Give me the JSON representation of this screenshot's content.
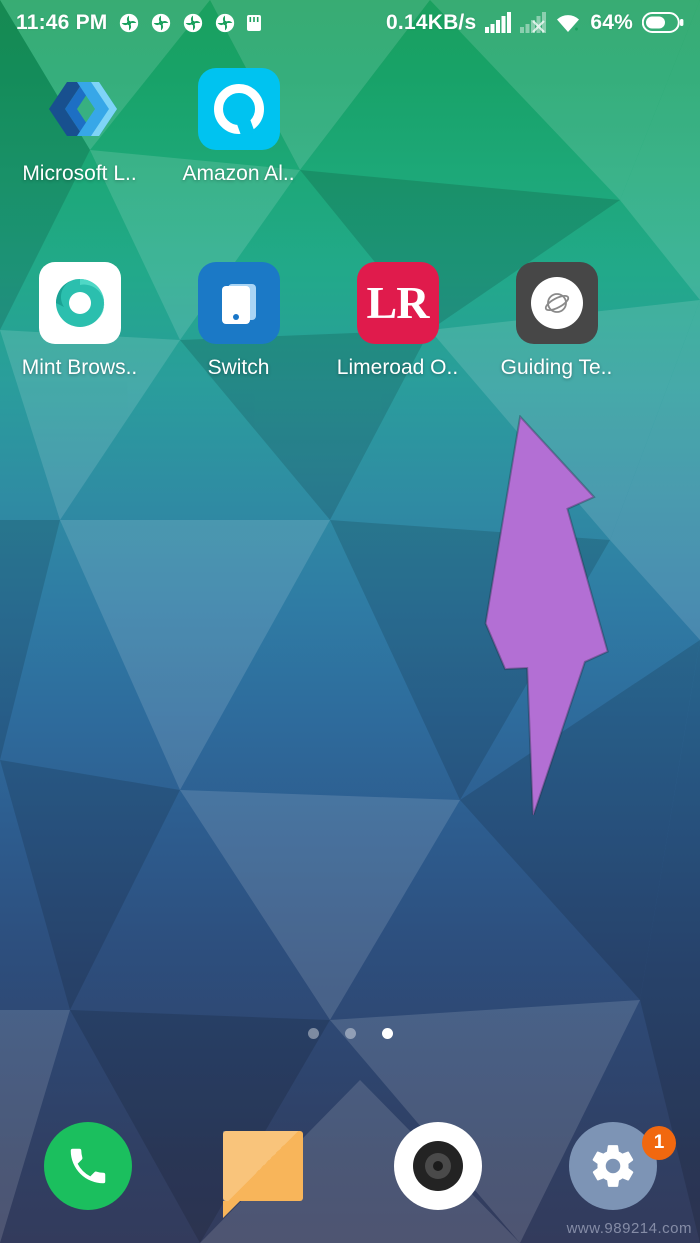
{
  "status_bar": {
    "time": "11:46 PM",
    "left_icons": [
      "sync-icon",
      "sync-icon",
      "sync-icon",
      "sync-icon",
      "sd-card-icon"
    ],
    "network_speed": "0.14KB/s",
    "right_icons": [
      "signal-bars-full-icon",
      "signal-bars-none-icon",
      "wifi-icon"
    ],
    "battery_percent": "64%",
    "battery_icon": "battery-icon"
  },
  "home_screen": {
    "rows": [
      {
        "apps": [
          {
            "label": "Microsoft L..",
            "icon": "microsoft-launcher-icon"
          },
          {
            "label": "Amazon Al..",
            "icon": "amazon-alexa-icon"
          }
        ]
      },
      {
        "apps": [
          {
            "label": "Mint Brows..",
            "icon": "mint-browser-icon"
          },
          {
            "label": "Switch",
            "icon": "switch-icon"
          },
          {
            "label": "Limeroad O..",
            "icon": "limeroad-icon",
            "glyph": "LR"
          },
          {
            "label": "Guiding Te..",
            "icon": "guiding-tech-icon"
          }
        ]
      }
    ],
    "page_indicator": {
      "count": 3,
      "active_index": 2
    }
  },
  "dock": {
    "items": [
      {
        "label": "Phone",
        "icon": "phone-icon"
      },
      {
        "label": "Messages",
        "icon": "message-bubble-icon"
      },
      {
        "label": "Camera",
        "icon": "camera-icon"
      },
      {
        "label": "Settings",
        "icon": "gear-icon",
        "badge": "1"
      }
    ]
  },
  "annotation": {
    "arrow": {
      "color": "#b36fd4",
      "direction": "up-right",
      "points_to": "Guiding Te.."
    }
  },
  "watermark": {
    "text": "www.989214.com"
  },
  "colors": {
    "wallpaper_top": "#1aa05e",
    "wallpaper_bottom": "#333b5c",
    "alexa_blue": "#00c3f0",
    "limeroad_pink": "#e01b4c",
    "switch_blue": "#1b79c6",
    "guiding_tech_dark": "#474747",
    "mint_teal": "#1fc0ae",
    "phone_green": "#1bbf5e",
    "message_orange": "#f8b55a",
    "settings_grayblue": "#7d94b5",
    "badge_orange": "#f1680f",
    "arrow_purple": "#b36fd4"
  }
}
